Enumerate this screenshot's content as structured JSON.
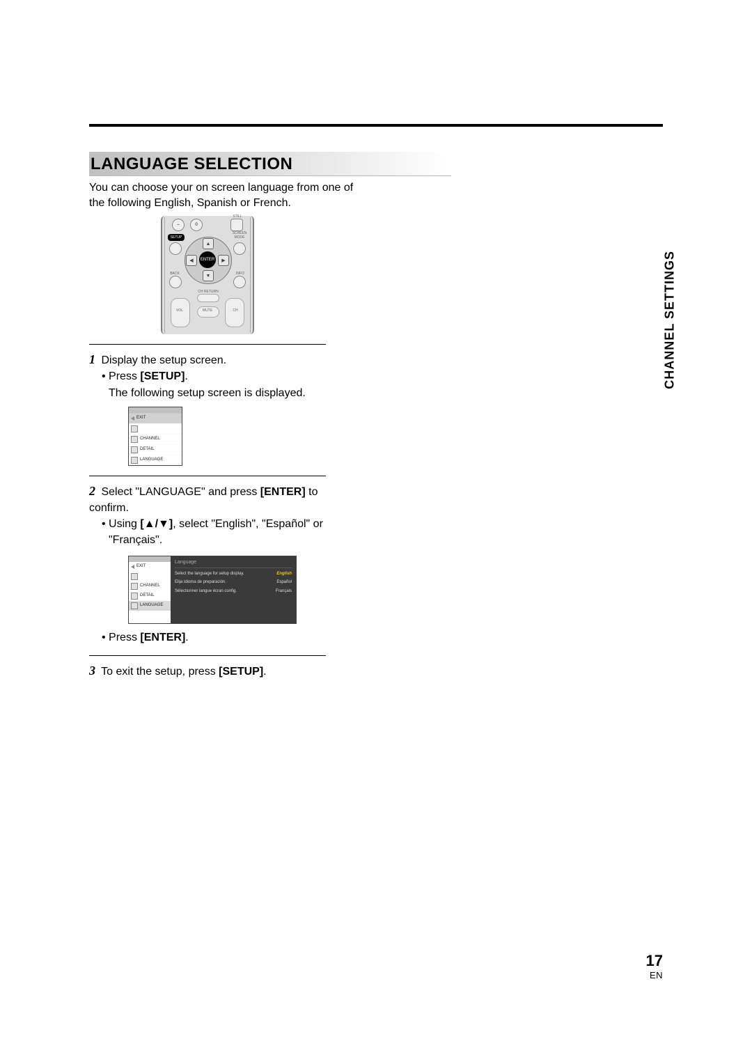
{
  "heading": "LANGUAGE SELECTION",
  "intro": "You can choose your on screen language from one of the following English, Spanish or French.",
  "remote": {
    "still": "STILL",
    "zero": "0",
    "setup": "SETUP",
    "screen_mode": "SCREEN MODE",
    "enter": "ENTER",
    "back": "BACK",
    "info": "INFO",
    "ch_return": "CH RETURN",
    "vol": "VOL",
    "mute": "MUTE",
    "ch": "CH"
  },
  "steps": {
    "s1": {
      "num": "1",
      "text": "Display the setup screen.",
      "b1_pre": "• Press ",
      "b1_bold": "[SETUP]",
      "b1_post": ".",
      "cont": "The following setup screen is displayed."
    },
    "s2": {
      "num": "2",
      "text_pre": "Select \"LANGUAGE\" and press ",
      "text_bold": "[ENTER]",
      "text_post": " to confirm.",
      "b1_pre": "• Using ",
      "b1_bold": "[▲/▼]",
      "b1_post": ", select \"English\", \"Español\" or \"Français\".",
      "b2_pre": "• Press ",
      "b2_bold": "[ENTER]",
      "b2_post": "."
    },
    "s3": {
      "num": "3",
      "text_pre": "To exit the setup, press ",
      "text_bold": "[SETUP]",
      "text_post": "."
    }
  },
  "menu": {
    "items": [
      "EXIT",
      "",
      "CHANNEL",
      "DETAIL",
      "LANGUAGE"
    ]
  },
  "lang_panel": {
    "title": "Language",
    "lines": [
      {
        "text": "Select the language for setup display.",
        "opt": "English",
        "sel": true
      },
      {
        "text": "Elija idioma de preparación.",
        "opt": "Español",
        "sel": false
      },
      {
        "text": "Sélectionner langue écran config.",
        "opt": "Français",
        "sel": false
      }
    ]
  },
  "side_tab": "CHANNEL SETTINGS",
  "footer": {
    "page": "17",
    "lang": "EN"
  }
}
